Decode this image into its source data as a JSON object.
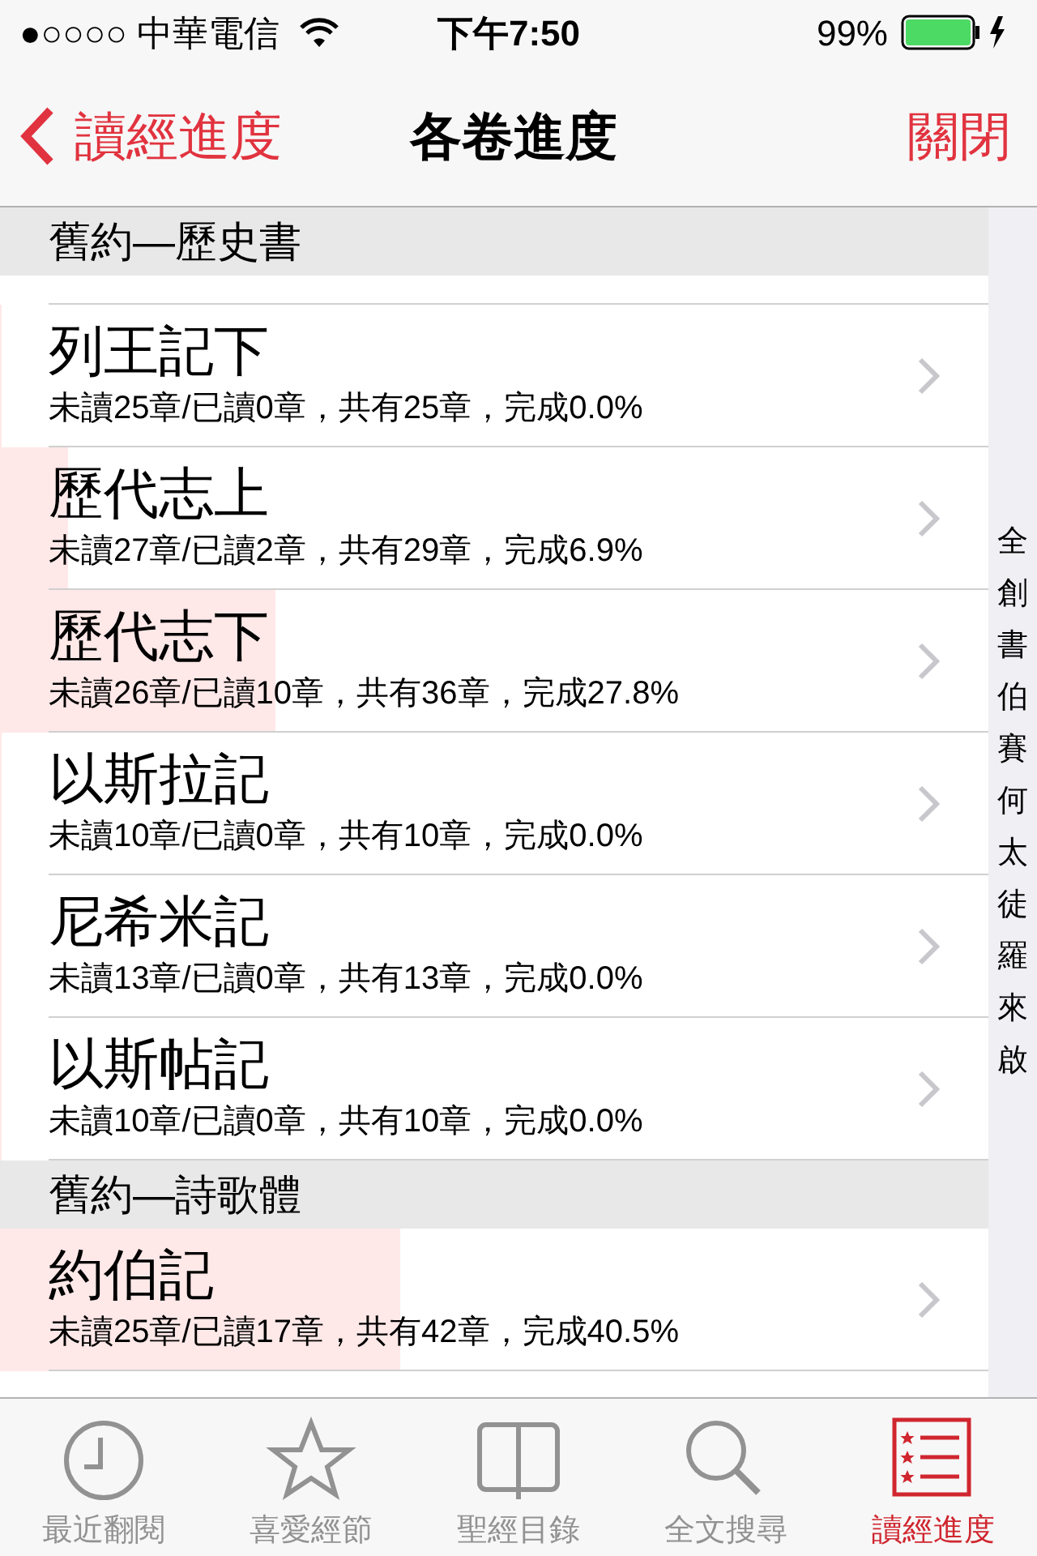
{
  "status_bar": {
    "carrier": "●○○○○ 中華電信",
    "time": "下午7:50",
    "battery": "99%"
  },
  "nav": {
    "back": "讀經進度",
    "title": "各卷進度",
    "close": "關閉"
  },
  "sections": [
    {
      "title": "舊約—歷史書",
      "rows": [
        {
          "name": "列王記下",
          "detail": "未讀25章/已讀0章，共有25章，完成0.0%",
          "level": 0.0
        },
        {
          "name": "歷代志上",
          "detail": "未讀27章/已讀2章，共有29章，完成6.9%",
          "level": 0.069
        },
        {
          "name": "歷代志下",
          "detail": "未讀26章/已讀10章，共有36章，完成27.8%",
          "level": 0.278
        },
        {
          "name": "以斯拉記",
          "detail": "未讀10章/已讀0章，共有10章，完成0.0%",
          "level": 0.0
        },
        {
          "name": "尼希米記",
          "detail": "未讀13章/已讀0章，共有13章，完成0.0%",
          "level": 0.0
        },
        {
          "name": "以斯帖記",
          "detail": "未讀10章/已讀0章，共有10章，完成0.0%",
          "level": 0.0
        }
      ]
    },
    {
      "title": "舊約—詩歌體",
      "rows": [
        {
          "name": "約伯記",
          "detail": "未讀25章/已讀17章，共有42章，完成40.5%",
          "level": 0.405
        }
      ]
    }
  ],
  "index": [
    "全",
    "創",
    "書",
    "伯",
    "賽",
    "何",
    "太",
    "徒",
    "羅",
    "來",
    "啟"
  ],
  "tabs": [
    {
      "label": "最近翻閱",
      "kind": "clock",
      "selected": false
    },
    {
      "label": "喜愛經節",
      "kind": "star",
      "selected": false
    },
    {
      "label": "聖經目錄",
      "kind": "book",
      "selected": false
    },
    {
      "label": "全文搜尋",
      "kind": "search",
      "selected": false
    },
    {
      "label": "讀經進度",
      "kind": "list",
      "selected": true
    }
  ]
}
